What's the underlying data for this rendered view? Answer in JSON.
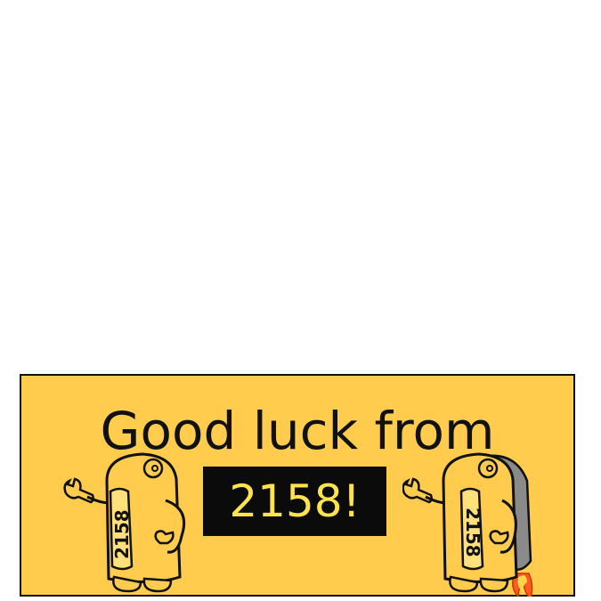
{
  "banner": {
    "headline": "Good luck from",
    "team": "2158!",
    "robot_label": "2158"
  },
  "colors": {
    "banner_background": "#ffcc4d",
    "team_box_background": "#0b0b0b",
    "team_text": "#ffe34a",
    "outline": "#111111"
  },
  "icons": {
    "left": "robot-waving-icon",
    "right": "robot-jetpack-icon"
  }
}
